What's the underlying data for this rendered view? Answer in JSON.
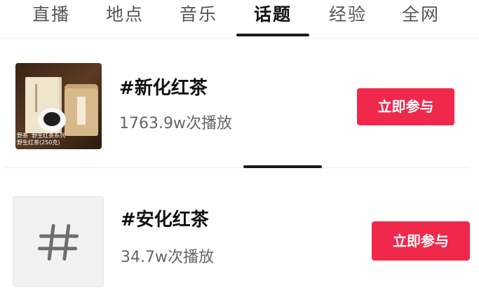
{
  "tabs": [
    {
      "label": "直播",
      "active": false
    },
    {
      "label": "地点",
      "active": false
    },
    {
      "label": "音乐",
      "active": false
    },
    {
      "label": "话题",
      "active": true
    },
    {
      "label": "经验",
      "active": false
    },
    {
      "label": "全网",
      "active": false
    }
  ],
  "topics": [
    {
      "title": "#新化红茶",
      "play_count": "1763.9w次播放",
      "button_label": "立即参与",
      "thumbnail": "tea-product-photo",
      "thumbnail_caption": "野茶  野生红茶系列\n野生红茶(250克)"
    },
    {
      "title": "#安化红茶",
      "play_count": "34.7w次播放",
      "button_label": "立即参与",
      "thumbnail": "hash-icon"
    }
  ],
  "colors": {
    "accent": "#f0284b",
    "active_tab_text": "#111111",
    "inactive_tab_text": "#555555",
    "secondary_text": "#666666",
    "divider": "#eeeeee"
  }
}
